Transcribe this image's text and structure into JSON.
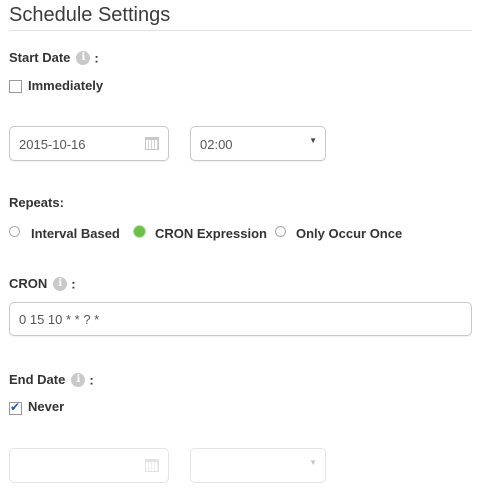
{
  "title": "Schedule Settings",
  "start_date": {
    "label": "Start Date",
    "colon": ":",
    "immediately": {
      "label": "Immediately",
      "checked": false
    },
    "date_value": "2015-10-16",
    "time_value": "02:00"
  },
  "repeats": {
    "label": "Repeats:",
    "options": [
      {
        "label": "Interval Based",
        "selected": false
      },
      {
        "label": "CRON Expression",
        "selected": true
      },
      {
        "label": "Only Occur Once",
        "selected": false
      }
    ]
  },
  "cron": {
    "label": "CRON",
    "colon": ":",
    "value": "0 15 10 * * ? *"
  },
  "end_date": {
    "label": "End Date",
    "colon": ":",
    "never": {
      "label": "Never",
      "checked": true
    },
    "date_value": "",
    "time_value": ""
  },
  "icons": {
    "info": "i",
    "calendar": "calendar-icon",
    "caret": "▼",
    "check": "✔"
  },
  "colors": {
    "radio_selected": "#6cbf47",
    "check": "#1c5fa7"
  }
}
